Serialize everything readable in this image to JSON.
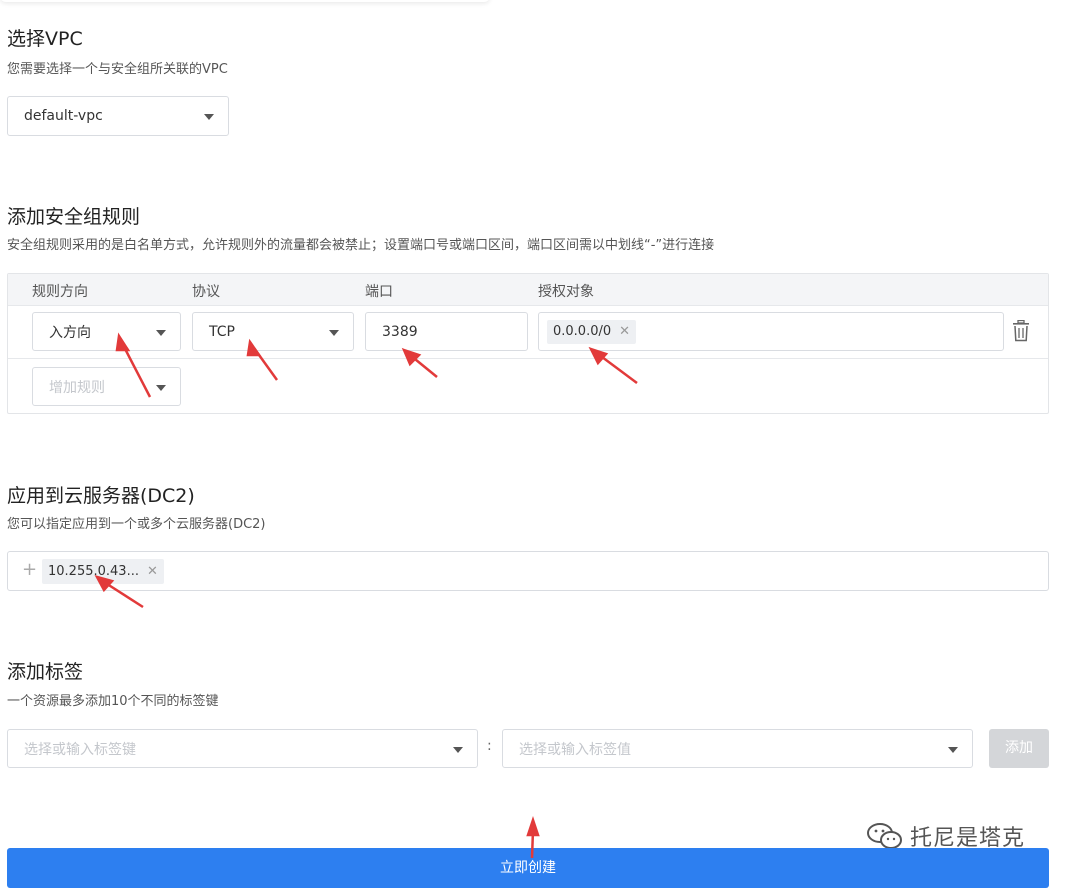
{
  "vpc_section": {
    "title": "选择VPC",
    "desc": "您需要选择一个与安全组所关联的VPC",
    "select_value": "default-vpc"
  },
  "rules_section": {
    "title": "添加安全组规则",
    "desc": "安全组规则采用的是白名单方式，允许规则外的流量都会被禁止；设置端口号或端口区间，端口区间需以中划线“-”进行连接",
    "headers": [
      "规则方向",
      "协议",
      "端口",
      "授权对象"
    ],
    "rule": {
      "direction": "入方向",
      "protocol": "TCP",
      "port": "3389",
      "auth_object": "0.0.0.0/0"
    },
    "add_rule_placeholder": "增加规则"
  },
  "servers_section": {
    "title": "应用到云服务器(DC2)",
    "desc": "您可以指定应用到一个或多个云服务器(DC2)",
    "server_tag": "10.255.0.43..."
  },
  "tags_section": {
    "title": "添加标签",
    "desc": "一个资源最多添加10个不同的标签键",
    "key_placeholder": "选择或输入标签键",
    "separator": ":",
    "value_placeholder": "选择或输入标签值",
    "add_button": "添加"
  },
  "create_button": "立即创建",
  "watermark": "托尼是塔克",
  "colors": {
    "primary": "#2d7ff0",
    "annotation_arrow": "#e23a3a",
    "disabled_button": "#d4d6d9"
  },
  "icons": {
    "trash": "trash-icon",
    "caret": "chevron-down-icon",
    "plus": "plus-icon",
    "close": "close-icon"
  }
}
